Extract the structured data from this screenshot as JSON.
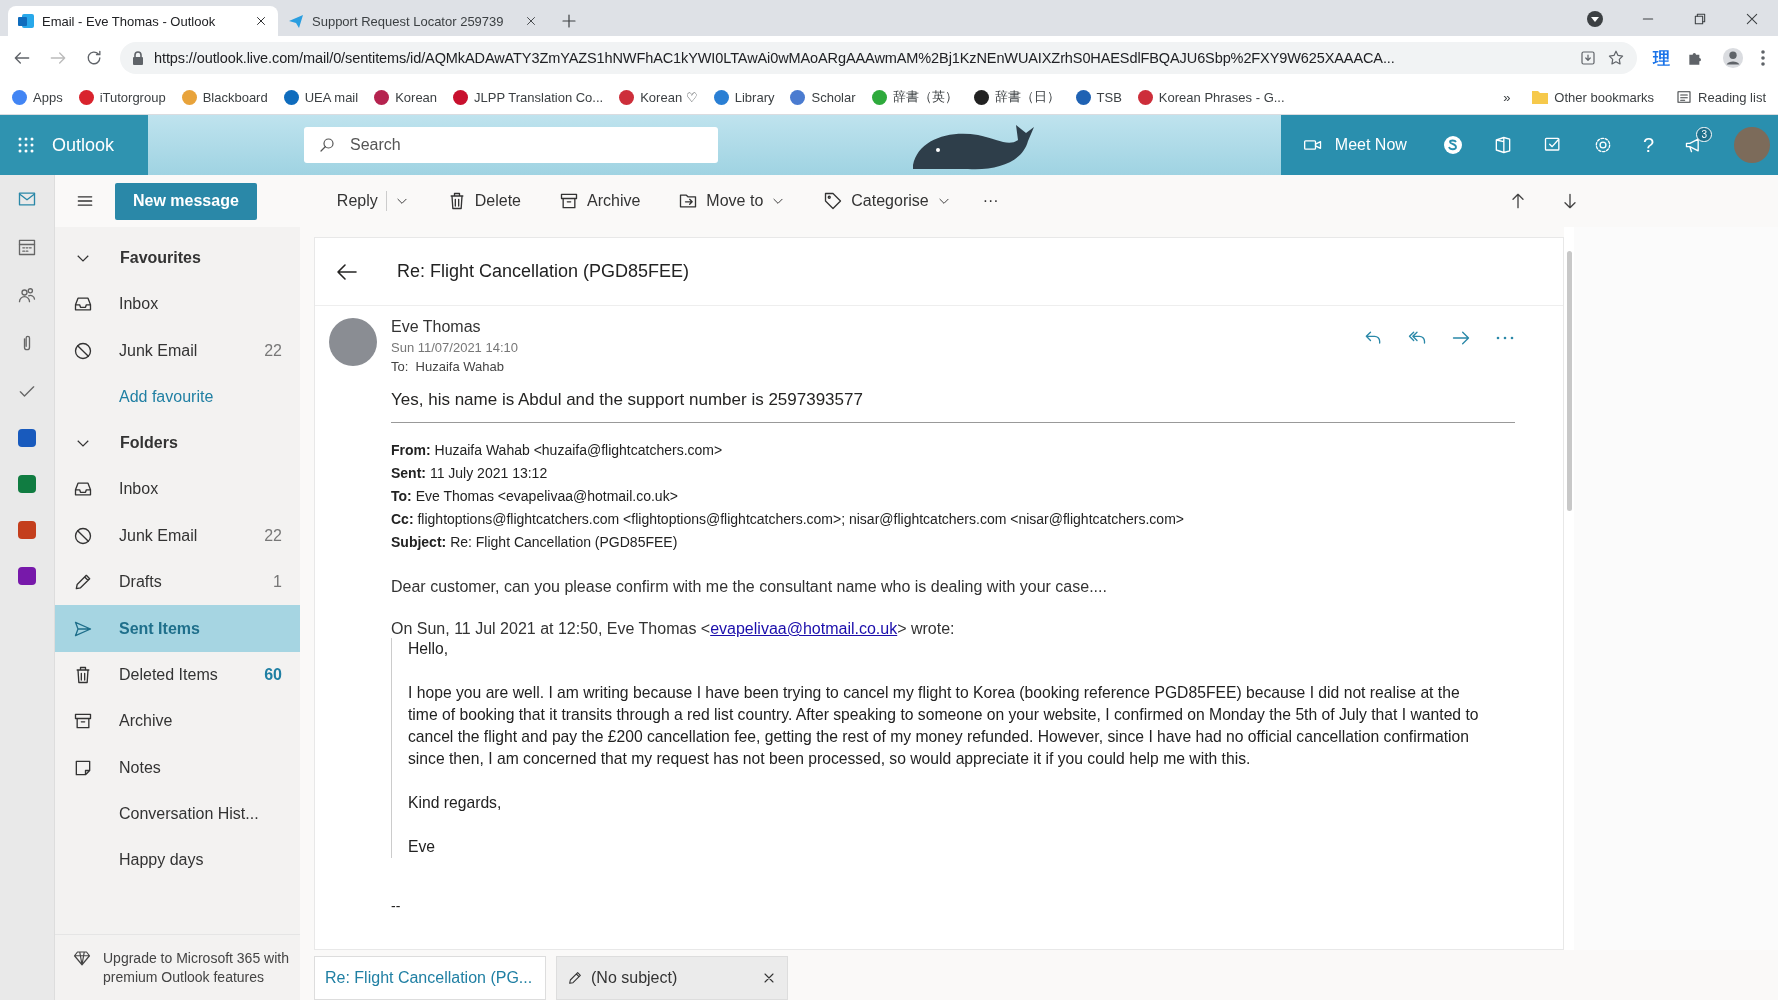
{
  "browser": {
    "tabs": [
      {
        "title": "Email - Eve Thomas - Outlook",
        "selected": true
      },
      {
        "title": "Support Request Locator 259739",
        "selected": false
      }
    ],
    "url": "https://outlook.live.com/mail/0/sentitems/id/AQMkADAwATY3ZmYAZS1hNWFhAC1kYWI0LTAwAi0wMAoARgAAAwmAM%2Bj1KzNEnWUAIXZrhS0HAESdlFBQAJU6Sbp%2FXY9W625XAAACA...",
    "extension_glyph": "理",
    "bookmarks": [
      {
        "label": "Apps",
        "color": "#4285f4"
      },
      {
        "label": "iTutorgroup",
        "color": "#d9232d"
      },
      {
        "label": "Blackboard",
        "color": "#e8a33b"
      },
      {
        "label": "UEA mail",
        "color": "#0f6cbd"
      },
      {
        "label": "Korean",
        "color": "#b5234f"
      },
      {
        "label": "JLPP Translation Co...",
        "color": "#c8102e"
      },
      {
        "label": "Korean ♡",
        "color": "#cd2e3a"
      },
      {
        "label": "Library",
        "color": "#2a7fd4"
      },
      {
        "label": "Scholar",
        "color": "#4a7bd0"
      },
      {
        "label": "辞書（英）",
        "color": "#2eaa3c"
      },
      {
        "label": "辞書（日）",
        "color": "#222222"
      },
      {
        "label": "TSB",
        "color": "#1f62b3"
      },
      {
        "label": "Korean Phrases - G...",
        "color": "#cd2e3a"
      }
    ],
    "more_bookmarks": "»",
    "other_bookmarks": "Other bookmarks",
    "reading_list": "Reading list"
  },
  "header": {
    "app_name": "Outlook",
    "search_placeholder": "Search",
    "meet_now": "Meet Now",
    "help": "?",
    "notification_count": "3"
  },
  "toolbar": {
    "new_message": "New message",
    "actions": [
      {
        "label": "Reply",
        "kind": "split",
        "dropdown": true
      },
      {
        "label": "Delete",
        "kind": "trash",
        "dropdown": false
      },
      {
        "label": "Archive",
        "kind": "archive",
        "dropdown": false
      },
      {
        "label": "Move to",
        "kind": "move",
        "dropdown": true
      },
      {
        "label": "Categorise",
        "kind": "tag",
        "dropdown": true
      }
    ],
    "more": "···"
  },
  "folder_pane": {
    "sections": [
      {
        "title": "Favourites",
        "expanded": true,
        "items": [
          {
            "label": "Inbox",
            "kind": "inbox",
            "selected": false
          },
          {
            "label": "Junk Email",
            "kind": "junk",
            "count": "22",
            "unread": false,
            "selected": false
          },
          {
            "label": "Add favourite",
            "kind": "link",
            "selected": false
          }
        ]
      },
      {
        "title": "Folders",
        "expanded": true,
        "items": [
          {
            "label": "Inbox",
            "kind": "inbox",
            "selected": false
          },
          {
            "label": "Junk Email",
            "kind": "junk",
            "count": "22",
            "unread": false,
            "selected": false
          },
          {
            "label": "Drafts",
            "kind": "pencil",
            "count": "1",
            "unread": false,
            "selected": false
          },
          {
            "label": "Sent Items",
            "kind": "send",
            "selected": true
          },
          {
            "label": "Deleted Items",
            "kind": "trash",
            "count": "60",
            "unread": true,
            "selected": false
          },
          {
            "label": "Archive",
            "kind": "archive",
            "selected": false
          },
          {
            "label": "Notes",
            "kind": "note",
            "selected": false
          },
          {
            "label": "Conversation Hist...",
            "kind": "plain",
            "selected": false
          },
          {
            "label": "Happy days",
            "kind": "plain",
            "selected": false
          }
        ]
      }
    ],
    "upgrade": "Upgrade to Microsoft 365 with premium Outlook features"
  },
  "email": {
    "subject": "Re: Flight Cancellation (PGD85FEE)",
    "sender": "Eve Thomas",
    "date": "Sun 11/07/2021 14:10",
    "to_label": "To:",
    "to": "Huzaifa Wahab",
    "reply": "Yes, his name is Abdul and the support number is 2597393577",
    "headers": [
      {
        "label": "From:",
        "value": "Huzaifa Wahab <huzaifa@flightcatchers.com>"
      },
      {
        "label": "Sent:",
        "value": "11 July 2021 13:12"
      },
      {
        "label": "To:",
        "value": "Eve Thomas <evapelivaa@hotmail.co.uk>"
      },
      {
        "label": "Cc:",
        "value": "flightoptions@flightcatchers.com <flightoptions@flightcatchers.com>; nisar@flightcatchers.com <nisar@flightcatchers.com>"
      },
      {
        "label": "Subject:",
        "value": "Re: Flight Cancellation (PGD85FEE)"
      }
    ],
    "message": "Dear customer, can you please confirm with me the consultant name who is dealing with your case....",
    "quote_intro_before": "On Sun, 11 Jul 2021 at 12:50, Eve Thomas <",
    "quote_link": "evapelivaa@hotmail.co.uk",
    "quote_intro_after": "> wrote:",
    "quote": [
      "Hello,",
      "I hope you are well. I am writing because I have been trying to cancel my flight to Korea (booking reference PGD85FEE) because I did not realise at the time of booking that it transits through a red list country. After speaking to someone on your website, I confirmed on Monday the 5th of July that I wanted to cancel the flight and pay the £200 cancellation fee, getting the rest of my money refunded. However, since I have had no official cancellation confirmation since then, I am concerned that my request has not been processed, so would appreciate it if you could help me with this.",
      "Kind regards,",
      "Eve"
    ],
    "signature": "--"
  },
  "bottom_tabs": [
    {
      "label": "Re: Flight Cancellation (PG...",
      "selected": true,
      "kind": "message"
    },
    {
      "label": "(No subject)",
      "selected": false,
      "kind": "draft"
    }
  ]
}
